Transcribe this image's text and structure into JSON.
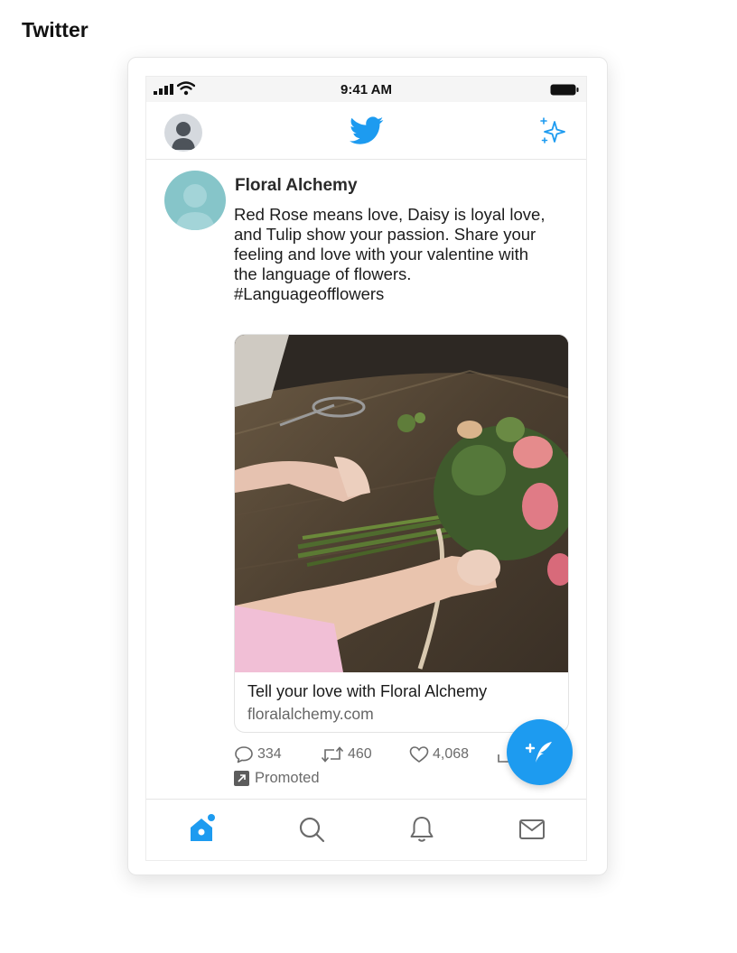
{
  "page": {
    "label": "Twitter"
  },
  "status_bar": {
    "time": "9:41 AM"
  },
  "tweet": {
    "author": "Floral Alchemy",
    "text_lines": [
      "Red Rose means love, Daisy is loyal love,",
      "and Tulip show your passion. Share your",
      "feeling and love with your valentine with",
      "the language of flowers.",
      "#Languageofflowers"
    ],
    "card": {
      "title": "Tell your love with Floral Alchemy",
      "domain": "floralalchemy.com",
      "image_icon": "flower-bouquet-photo"
    },
    "actions": {
      "replies": "334",
      "retweets": "460",
      "likes": "4,068"
    },
    "promoted_label": "Promoted"
  },
  "nav": {
    "items": [
      {
        "name": "home",
        "icon": "home-icon"
      },
      {
        "name": "search",
        "icon": "search-icon"
      },
      {
        "name": "notifications",
        "icon": "bell-icon"
      },
      {
        "name": "messages",
        "icon": "mail-icon"
      }
    ]
  },
  "colors": {
    "brand_blue": "#1d9bf0",
    "text_gray": "#6b6b6b",
    "author_avatar": "#86c5c9"
  }
}
